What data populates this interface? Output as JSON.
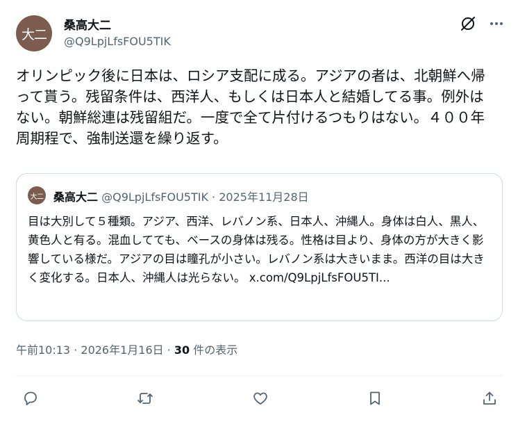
{
  "author": {
    "avatar_text": "大二",
    "display_name": "桑高大二",
    "handle": "@Q9LpjLfsFOU5TIK"
  },
  "post": {
    "text": "オリンピック後に日本は、ロシア支配に成る。アジアの者は、北朝鮮へ帰って貰う。残留条件は、西洋人、もしくは日本人と結婚してる事。例外はない。朝鮮総連は残留組だ。一度で全て片付けるつもりはない。４００年周期程で、強制送還を繰り返す。",
    "time": "午前10:13",
    "date": "2026年1月16日",
    "separator": " · ",
    "views_count": "30",
    "views_label": " 件の表示"
  },
  "quote": {
    "avatar_text": "大二",
    "display_name": "桑高大二",
    "handle": "@Q9LpjLfsFOU5TIK",
    "date": "2025年11月28日",
    "text": "目は大別して５種類。アジア、西洋、レバノン系、日本人、沖縄人。身体は白人、黒人、黄色人と有る。混血してても、ベースの身体は残る。性格は目より、身体の方が大きく影響している様だ。アジアの目は瞳孔が小さい。レバノン系は大きいまま。西洋の目は大きく変化する。日本人、沖縄人は光らない。",
    "link": "x.com/Q9LpjLfsFOU5TI..."
  },
  "icons": {
    "grok": "grok-icon",
    "more": "more-icon",
    "reply": "reply-icon",
    "repost": "repost-icon",
    "like": "like-icon",
    "bookmark": "bookmark-icon",
    "share": "share-icon"
  },
  "colors": {
    "text": "#0f1419",
    "secondary": "#536471",
    "border": "#cfd9de",
    "avatar_bg": "#7c5c4e"
  }
}
